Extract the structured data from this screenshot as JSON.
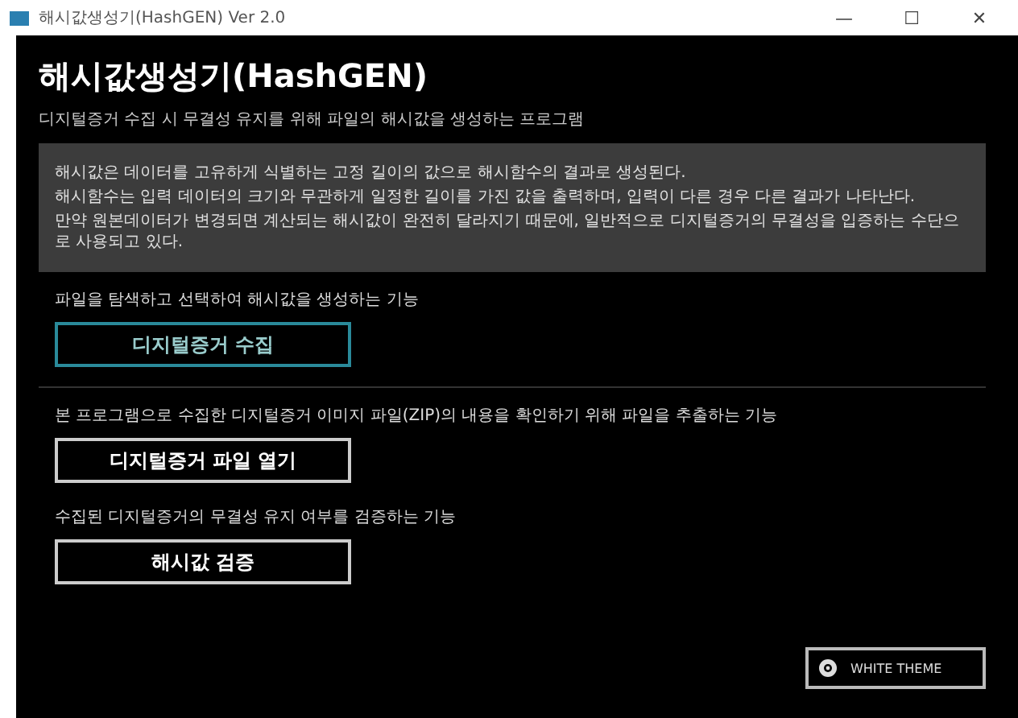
{
  "window": {
    "title": "해시값생성기(HashGEN) Ver 2.0",
    "controls": [
      "—",
      "☐",
      "✕"
    ]
  },
  "header": {
    "title": "해시값생성기(HashGEN)",
    "subtitle": "디지털증거 수집 시 무결성 유지를 위해 파일의 해시값을 생성하는 프로그램"
  },
  "info": [
    "해시값은 데이터를 고유하게 식별하는 고정 길이의 값으로 해시함수의 결과로 생성된다.",
    "해시함수는 입력 데이터의 크기와 무관하게 일정한 길이를 가진 값을 출력하며, 입력이 다른 경우 다른 결과가 나타난다.",
    "만약 원본데이터가 변경되면 계산되는 해시값이 완전히 달라지기 때문에, 일반적으로 디지털증거의 무결성을 입증하는 수단으로 사용되고 있다."
  ],
  "sections": [
    {
      "description": "파일을 탐색하고 선택하여 해시값을 생성하는 기능",
      "button": "디지털증거 수집",
      "focused": true
    },
    {
      "description": "본 프로그램으로 수집한 디지털증거 이미지 파일(ZIP)의 내용을 확인하기 위해 파일을 추출하는 기능",
      "button": "디지털증거 파일 열기",
      "focused": false
    },
    {
      "description": "수집된 디지털증거의 무결성 유지 여부를 검증하는 기능",
      "button": "해시값 검증",
      "focused": false
    }
  ],
  "theme_button": {
    "label": "WHITE THEME"
  }
}
